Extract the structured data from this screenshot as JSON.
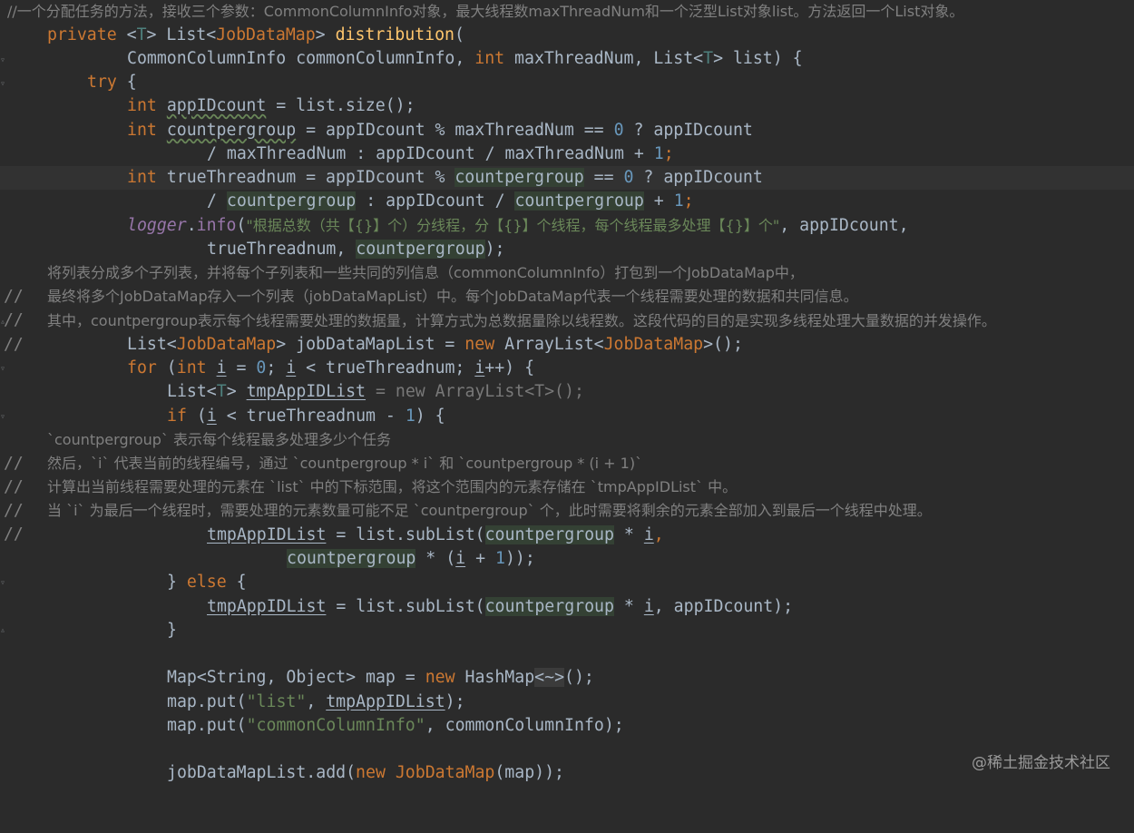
{
  "editor": {
    "lines": [
      {
        "id": "l0",
        "type": "comment",
        "text": "//一个分配任务的方法，接收三个参数：CommonColumnInfo对象，最大线程数maxThreadNum和一个泛型List对象list。方法返回一个List对象。"
      },
      {
        "id": "l1",
        "type": "code"
      },
      {
        "id": "l2",
        "type": "code"
      },
      {
        "id": "l3",
        "type": "code"
      },
      {
        "id": "l4",
        "type": "code"
      },
      {
        "id": "l5",
        "type": "code"
      },
      {
        "id": "l6",
        "type": "code"
      },
      {
        "id": "l7",
        "type": "code"
      },
      {
        "id": "l8",
        "type": "code"
      },
      {
        "id": "l9",
        "type": "code"
      },
      {
        "id": "l10",
        "type": "code"
      },
      {
        "id": "l11",
        "type": "comment",
        "text": "将列表分成多个子列表，并将每个子列表和一些共同的列信息（commonColumnInfo）打包到一个JobDataMap中，"
      },
      {
        "id": "l12",
        "type": "comment",
        "text": "最终将多个JobDataMap存入一个列表（jobDataMapList）中。每个JobDataMap代表一个线程需要处理的数据和共同信息。"
      },
      {
        "id": "l13",
        "type": "comment",
        "text": "其中，countpergroup表示每个线程需要处理的数据量，计算方式为总数据量除以线程数。这段代码的目的是实现多线程处理大量数据的并发操作。"
      },
      {
        "id": "l19",
        "type": "comment",
        "text": "`countpergroup` 表示每个线程最多处理多少个任务"
      },
      {
        "id": "l20",
        "type": "comment",
        "text": "然后，`i` 代表当前的线程编号，通过 `countpergroup * i` 和 `countpergroup * (i + 1)`"
      },
      {
        "id": "l21",
        "type": "comment",
        "text": "计算出当前线程需要处理的元素在 `list` 中的下标范围，将这个范围内的元素存储在 `tmpAppIDList` 中。"
      },
      {
        "id": "l22",
        "type": "comment",
        "text": "当 `i` 为最后一个线程时，需要处理的元素数量可能不足 `countpergroup` 个，此时需要将剩余的元素全部加入到最后一个线程中处理。"
      }
    ],
    "code": {
      "l1": [
        "private",
        " <",
        "T",
        "> List<",
        "JobDataMap",
        "> ",
        "distribution",
        "("
      ],
      "l2": [
        "CommonColumnInfo commonColumnInfo, ",
        "int",
        " maxThreadNum, List<",
        "T",
        "> list) {"
      ],
      "l3": [
        "try",
        " {"
      ],
      "l4": [
        "int",
        " ",
        "appIDcount",
        " = list.size();"
      ],
      "l5": [
        "int",
        " ",
        "countpergroup",
        " = appIDcount % maxThreadNum == ",
        "0",
        " ? appIDcount"
      ],
      "l6": [
        "/ maxThreadNum : appIDcount / maxThreadNum + ",
        "1",
        ";"
      ],
      "l7": [
        "int",
        " trueThreadnum = appIDcount % ",
        "countpergroup",
        " == ",
        "0",
        " ? appIDcount"
      ],
      "l8": [
        "/ ",
        "countpergroup",
        " : appIDcount / ",
        "countpergroup",
        " + ",
        "1",
        ";"
      ],
      "l9": [
        "logger",
        ".",
        "info",
        "(",
        "\"根据总数（共【{}】个）分线程，分【{}】个线程，每个线程最多处理【{}】个\"",
        ", appIDcount,"
      ],
      "l10": [
        "trueThreadnum, ",
        "countpergroup",
        ");"
      ],
      "l14": [
        "List<",
        "JobDataMap",
        "> jobDataMapList = ",
        "new",
        " ArrayList<",
        "JobDataMap",
        ">();"
      ],
      "l15": [
        "for",
        " (",
        "int",
        " ",
        "i",
        " = ",
        "0",
        "; ",
        "i",
        " < trueThreadnum; ",
        "i",
        "++) {"
      ],
      "l16": [
        "List<",
        "T",
        "> ",
        "tmpAppIDList",
        " = new ArrayList<T>();"
      ],
      "l17": [
        "if",
        " (",
        "i",
        " < trueThreadnum - ",
        "1",
        ") {"
      ],
      "l23": [
        "tmpAppIDList",
        " = list.subList(",
        "countpergroup",
        " * ",
        "i",
        ","
      ],
      "l24": [
        "countpergroup",
        " * (",
        "i",
        " + ",
        "1",
        "));"
      ],
      "l25": [
        "} ",
        "else",
        " {"
      ],
      "l26": [
        "tmpAppIDList",
        " = list.subList(",
        "countpergroup",
        " * ",
        "i",
        ", appIDcount);"
      ],
      "l27": [
        "}"
      ],
      "l29": [
        "Map<String, Object> map = ",
        "new",
        " HashMap",
        "<~>",
        "();"
      ],
      "l30": [
        "map.put(",
        "\"list\"",
        ", ",
        "tmpAppIDList",
        ");"
      ],
      "l31": [
        "map.put(",
        "\"commonColumnInfo\"",
        ", commonColumnInfo);"
      ],
      "l33": [
        "jobDataMapList.add(",
        "new",
        " ",
        "JobDataMap",
        "(map));"
      ]
    }
  },
  "watermark": "@稀土掘金技术社区"
}
